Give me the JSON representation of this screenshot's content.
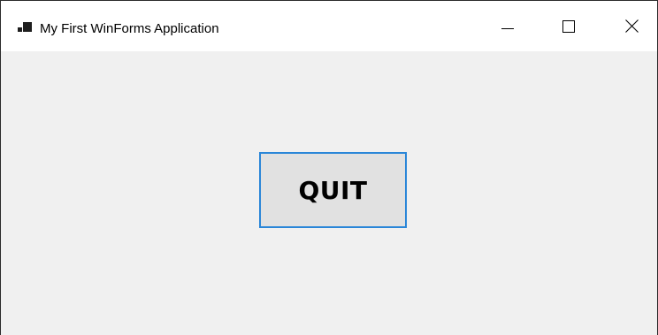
{
  "window": {
    "title": "My First WinForms Application",
    "app_icon": "winforms-app-icon",
    "controls": {
      "minimize_icon": "minimize-icon",
      "maximize_icon": "maximize-icon",
      "close_icon": "close-icon"
    }
  },
  "form": {
    "quit_button_label": "QUIT"
  },
  "colors": {
    "client_background": "#f0f0f0",
    "titlebar_background": "#ffffff",
    "button_face": "#e1e1e1",
    "button_focus_border": "#2a86d8"
  }
}
